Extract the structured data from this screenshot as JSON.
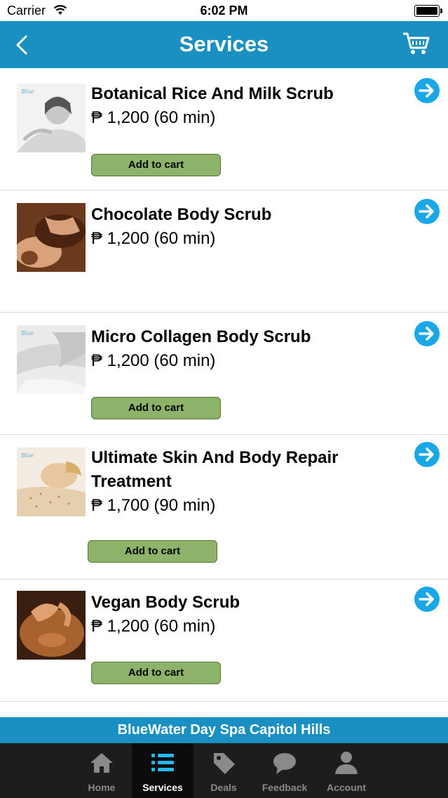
{
  "status_bar": {
    "carrier": "Carrier",
    "time": "6:02 PM"
  },
  "nav": {
    "title": "Services",
    "back_icon": "chevron-left-icon",
    "cart_icon": "cart-icon"
  },
  "colors": {
    "accent": "#1a8fc2",
    "button_green": "#8db36a",
    "arrow_blue": "#1aa7e8",
    "tabbar": "#1d1d1d"
  },
  "services": [
    {
      "name": "Botanical Rice And Milk Scrub",
      "price": "₱ 1,200 (60 min)",
      "button": "Add to cart",
      "image": "woman-receiving-massage"
    },
    {
      "name": "Chocolate Body Scrub",
      "price": "₱ 1,200 (60 min)",
      "button": "",
      "image": "chocolate-scrub-application"
    },
    {
      "name": "Micro Collagen Body Scrub",
      "price": "₱ 1,200 (60 min)",
      "button": "Add to cart",
      "image": "back-massage-white"
    },
    {
      "name": "Ultimate Skin And Body Repair Treatment",
      "price": "₱ 1,700 (90 min)",
      "button": "Add to cart",
      "image": "body-scrub-woman"
    },
    {
      "name": "Vegan Body Scrub",
      "price": "₱ 1,200 (60 min)",
      "button": "Add to cart",
      "image": "back-massage-dark"
    }
  ],
  "banner": {
    "text": "BlueWater Day Spa Capitol Hills"
  },
  "tabs": [
    {
      "label": "Home",
      "icon": "home-icon",
      "active": false
    },
    {
      "label": "Services",
      "icon": "list-icon",
      "active": true
    },
    {
      "label": "Deals",
      "icon": "tag-icon",
      "active": false
    },
    {
      "label": "Feedback",
      "icon": "speech-bubble-icon",
      "active": false
    },
    {
      "label": "Account",
      "icon": "person-icon",
      "active": false
    }
  ]
}
